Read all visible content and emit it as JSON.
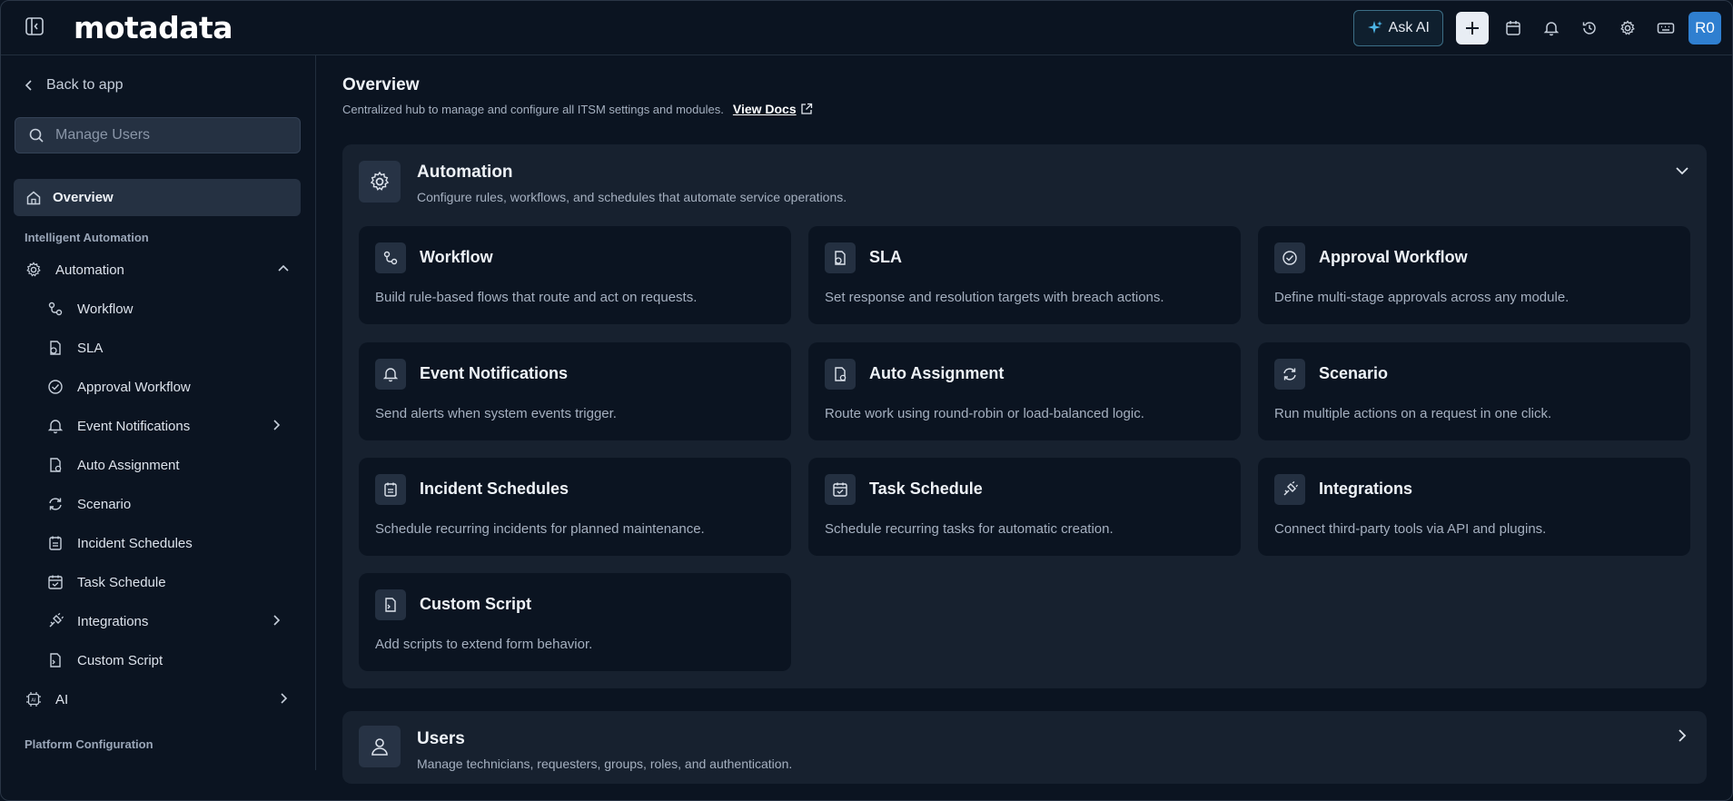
{
  "header": {
    "logo": "motadata",
    "ask_ai_label": "Ask AI",
    "avatar_initials": "R0",
    "icons": [
      "sidebar-collapse-icon",
      "sparkle-icon",
      "plus-icon",
      "calendar-icon",
      "bell-icon",
      "history-icon",
      "gear-icon",
      "keyboard-icon"
    ]
  },
  "sidebar": {
    "back_label": "Back to app",
    "search_placeholder": "Manage Users",
    "overview_label": "Overview",
    "section_intelligent": "Intelligent Automation",
    "automation_label": "Automation",
    "items": [
      {
        "label": "Workflow",
        "icon": "workflow-icon"
      },
      {
        "label": "SLA",
        "icon": "sla-icon"
      },
      {
        "label": "Approval Workflow",
        "icon": "check-circle-icon"
      },
      {
        "label": "Event Notifications",
        "icon": "bell-icon",
        "has_children": true
      },
      {
        "label": "Auto Assignment",
        "icon": "auto-assign-icon"
      },
      {
        "label": "Scenario",
        "icon": "refresh-icon"
      },
      {
        "label": "Incident Schedules",
        "icon": "calendar-list-icon"
      },
      {
        "label": "Task Schedule",
        "icon": "calendar-check-icon"
      },
      {
        "label": "Integrations",
        "icon": "plug-icon",
        "has_children": true
      },
      {
        "label": "Custom Script",
        "icon": "script-icon"
      }
    ],
    "ai_label": "AI",
    "section_platform": "Platform Configuration"
  },
  "main": {
    "title": "Overview",
    "subtitle": "Centralized hub to manage and configure all ITSM settings and modules.",
    "view_docs": "View Docs",
    "automation_panel": {
      "title": "Automation",
      "description": "Configure rules, workflows, and schedules that automate service operations.",
      "cards": [
        {
          "title": "Workflow",
          "description": "Build rule-based flows that route and act on requests."
        },
        {
          "title": "SLA",
          "description": "Set response and resolution targets with breach actions."
        },
        {
          "title": "Approval Workflow",
          "description": "Define multi-stage approvals across any module."
        },
        {
          "title": "Event Notifications",
          "description": "Send alerts when system events trigger."
        },
        {
          "title": "Auto Assignment",
          "description": "Route work using round-robin or load-balanced logic."
        },
        {
          "title": "Scenario",
          "description": "Run multiple actions on a request in one click."
        },
        {
          "title": "Incident Schedules",
          "description": "Schedule recurring incidents for planned maintenance."
        },
        {
          "title": "Task Schedule",
          "description": "Schedule recurring tasks for automatic creation."
        },
        {
          "title": "Integrations",
          "description": "Connect third-party tools via API and plugins."
        },
        {
          "title": "Custom Script",
          "description": "Add scripts to extend form behavior."
        }
      ]
    },
    "users_panel": {
      "title": "Users",
      "description": "Manage technicians, requesters, groups, roles, and authentication."
    }
  }
}
